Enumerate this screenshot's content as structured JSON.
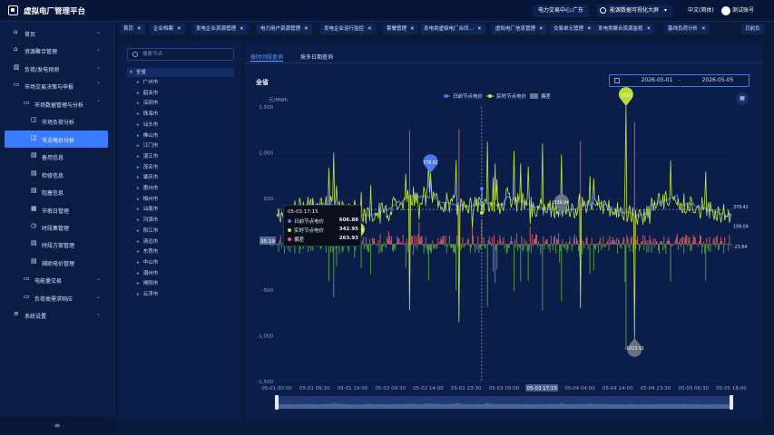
{
  "app": {
    "title": "虚拟电厂管理平台"
  },
  "header": {
    "center_label": "电力交易中心:广东",
    "bigscreen_label": "能源数据可视化大屏",
    "lang_label": "中文(简体)",
    "user_name": "测试账号"
  },
  "sidebar": {
    "items": [
      {
        "label": "首页",
        "level": 0,
        "icon": "home-icon",
        "chev": true
      },
      {
        "label": "资源聚合管理",
        "level": 0,
        "icon": "home-icon",
        "chev": true
      },
      {
        "label": "负荷/发电预测",
        "level": 0,
        "icon": "chart-icon",
        "chev": true
      },
      {
        "label": "市场交易决策与申报",
        "level": 0,
        "icon": "monitor-icon",
        "chev": true,
        "open": true
      },
      {
        "label": "市场数据管理与分析",
        "level": 1,
        "icon": "monitor-icon",
        "chev": true,
        "open": true
      },
      {
        "label": "市场负荷分析",
        "level": 2,
        "icon": "analysis-icon"
      },
      {
        "label": "节点电价分析",
        "level": 2,
        "icon": "analysis-icon",
        "active": true
      },
      {
        "label": "备用信息",
        "level": 2,
        "icon": "doc-icon"
      },
      {
        "label": "检修信息",
        "level": 2,
        "icon": "doc-icon"
      },
      {
        "label": "阻塞信息",
        "level": 2,
        "icon": "doc-icon"
      },
      {
        "label": "节假日管理",
        "level": 2,
        "icon": "calendar-icon"
      },
      {
        "label": "时段集管理",
        "level": 2,
        "icon": "clock-icon"
      },
      {
        "label": "时段方案管理",
        "level": 2,
        "icon": "doc-icon"
      },
      {
        "label": "辅助电价管理",
        "level": 2,
        "icon": "doc-icon"
      },
      {
        "label": "电能量交易",
        "level": 1,
        "icon": "monitor-icon",
        "chev": true
      },
      {
        "label": "负荷类需求响应",
        "level": 1,
        "icon": "monitor-icon",
        "chev": true
      },
      {
        "label": "系统设置",
        "level": 0,
        "icon": "settings-icon",
        "chev": true
      }
    ],
    "collapse_icon": "≡"
  },
  "tabs": [
    {
      "label": "首页",
      "close": true
    },
    {
      "label": "企业档案",
      "close": true
    },
    {
      "label": "发电企业资源管理",
      "close": true
    },
    {
      "label": "电力用户资源管理",
      "close": true
    },
    {
      "label": "发电企业运行监控",
      "close": true
    },
    {
      "label": "套餐管理",
      "close": true
    },
    {
      "label": "发电类虚拟电厂合同…",
      "close": true
    },
    {
      "label": "虚拟电厂信息管理",
      "close": true
    },
    {
      "label": "交易单元管理",
      "close": true
    },
    {
      "label": "发电类聚合资源监视",
      "close": true
    },
    {
      "label": "基线负荷分析",
      "close": true
    },
    {
      "label": "日前负",
      "close": false
    }
  ],
  "tree": {
    "search_placeholder": "搜索节点",
    "root": "全省",
    "cities": [
      "广州市",
      "韶关市",
      "深圳市",
      "珠海市",
      "汕头市",
      "佛山市",
      "江门市",
      "湛江市",
      "茂名市",
      "肇庆市",
      "惠州市",
      "梅州市",
      "汕尾市",
      "河源市",
      "阳江市",
      "清远市",
      "东莞市",
      "中山市",
      "潮州市",
      "揭阳市",
      "云浮市"
    ]
  },
  "main": {
    "tab_active": "按时间段查询",
    "tab_other": "按多日期查询",
    "region_title": "全省",
    "date_start": "2026-05-01",
    "date_sep": "-",
    "date_end": "2026-05-05",
    "export_icon": "▦"
  },
  "chart_data": {
    "type": "line",
    "ylabel": "元/MWh",
    "ylim": [
      -1500,
      1500
    ],
    "yticks": [
      "1,500",
      "1,000",
      "500",
      "0",
      "-500",
      "-1,000",
      "-1,500"
    ],
    "xticks": [
      "05-01 00:00",
      "05-01 09:30",
      "05-01 19:00",
      "05-02 04:30",
      "05-02 14:00",
      "05-02 23:30",
      "05-03 09:00",
      "05-03 17:15",
      "05-04 04:00",
      "05-04 14:00",
      "05-04 23:30",
      "05-05 06:30",
      "05-05 18:00"
    ],
    "legend": [
      "日前节点电价",
      "实时节点电价",
      "偏差"
    ],
    "colors": {
      "dayahead": "#4f7df5",
      "realtime": "#c5e63a",
      "deviation": "#e3636b"
    },
    "markers": [
      {
        "label": "1510",
        "value": 1510
      },
      {
        "label": "776.61",
        "value": 776.61
      },
      {
        "label": "339.94",
        "value": 339.94
      },
      {
        "label": "35.19",
        "value": 35.19
      },
      {
        "label": "-1023.91",
        "value": -1023.91
      }
    ],
    "right_labels": [
      "199.04",
      "379.42",
      "-23.64"
    ],
    "left_tag": "35.19",
    "tooltip": {
      "time": "05-03 17:15",
      "rows": [
        {
          "name": "日前节点电价",
          "value": "606.88",
          "color": "#4f7df5"
        },
        {
          "name": "实时节点电价",
          "value": "342.95",
          "color": "#c5e63a"
        },
        {
          "name": "偏差",
          "value": "263.93",
          "color": "#e3636b"
        }
      ]
    }
  }
}
